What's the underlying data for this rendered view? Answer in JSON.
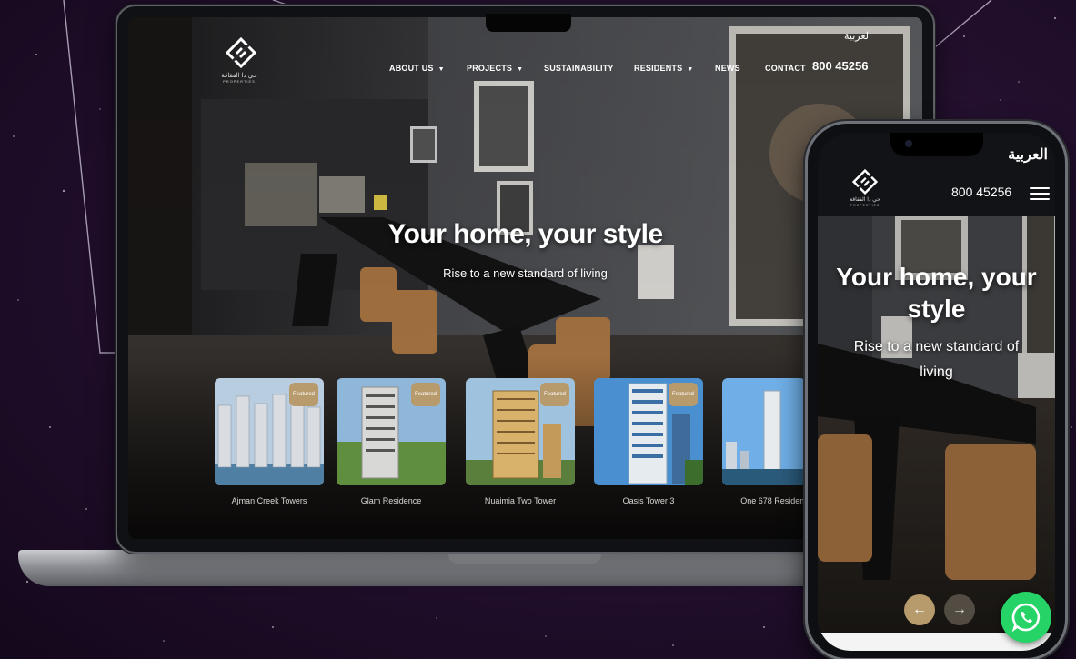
{
  "site": {
    "lang_link": "العربية",
    "phone": "800 45256",
    "logo_ar": "حي دا الفقاقة",
    "logo_en": "PROPERTIES"
  },
  "nav": [
    {
      "label": "ABOUT US",
      "dropdown": true
    },
    {
      "label": "PROJECTS",
      "dropdown": true
    },
    {
      "label": "SUSTAINABILITY",
      "dropdown": false
    },
    {
      "label": "RESIDENTS",
      "dropdown": true
    },
    {
      "label": "NEWS",
      "dropdown": false
    },
    {
      "label": "CONTACT",
      "dropdown": false
    }
  ],
  "hero": {
    "title": "Your home, your style",
    "subtitle": "Rise to a new standard of living"
  },
  "projects": [
    {
      "name": "Ajman Creek Towers",
      "badge": "Featured"
    },
    {
      "name": "Glam Residence",
      "badge": "Featured"
    },
    {
      "name": "Nuaimia Two Tower",
      "badge": "Featured"
    },
    {
      "name": "Oasis Tower 3",
      "badge": "Featured"
    },
    {
      "name": "One 678 Residence",
      "badge": ""
    }
  ],
  "mobile": {
    "lang_link": "العربية",
    "phone": "800 45256",
    "title": "Your home, your style",
    "subtitle": "Rise to a new standard of living"
  },
  "colors": {
    "accent_gold": "#b89b6d",
    "whatsapp_green": "#25d366",
    "background_purple": "#24102f"
  },
  "icons": {
    "logo": "diamond-logo-icon",
    "menu": "hamburger-icon",
    "prev": "arrow-left-icon",
    "next": "arrow-right-icon",
    "whatsapp": "whatsapp-icon"
  }
}
